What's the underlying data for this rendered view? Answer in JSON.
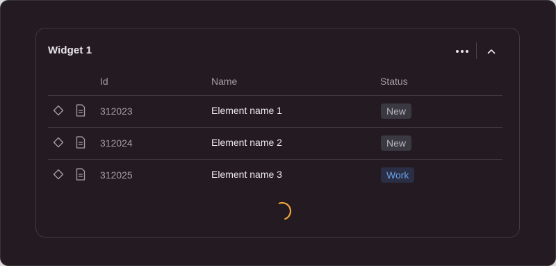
{
  "widget": {
    "title": "Widget 1"
  },
  "table": {
    "columns": [
      "Id",
      "Name",
      "Status"
    ],
    "rows": [
      {
        "id": "312023",
        "name": "Element name 1",
        "status": "New",
        "status_kind": "new"
      },
      {
        "id": "312024",
        "name": "Element name 2",
        "status": "New",
        "status_kind": "new"
      },
      {
        "id": "312025",
        "name": "Element name 3",
        "status": "Work",
        "status_kind": "work"
      }
    ]
  },
  "icons": {
    "more": "more-horizontal-icon",
    "collapse": "chevron-up-icon",
    "favorite": "diamond-icon",
    "document": "document-icon",
    "loader": "spinner-icon"
  },
  "colors": {
    "background": "#231b21",
    "border": "#413a40",
    "text_primary": "#ece8eb",
    "text_secondary": "#a59ea4",
    "badge_new_bg": "#3a3942",
    "badge_work_bg": "#2a2f45",
    "badge_work_text": "#6ba0e6",
    "spinner": "#f0a63a"
  }
}
